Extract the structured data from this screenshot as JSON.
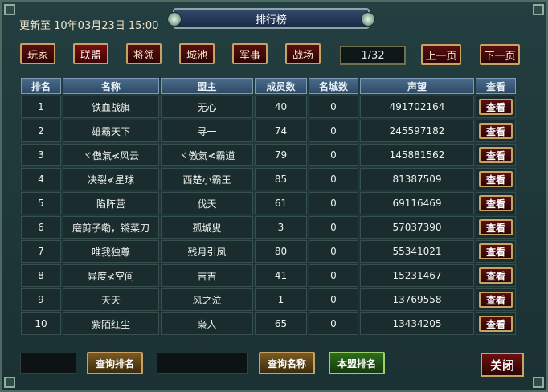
{
  "header": {
    "updated": "更新至 10年03月23日 15:00",
    "title": "排行榜"
  },
  "tabs": [
    {
      "label": "玩家",
      "active": false
    },
    {
      "label": "联盟",
      "active": true
    },
    {
      "label": "将领",
      "active": false
    },
    {
      "label": "城池",
      "active": false
    },
    {
      "label": "军事",
      "active": false
    },
    {
      "label": "战场",
      "active": false
    }
  ],
  "pagination": {
    "page": "1/32",
    "prev_label": "上一页",
    "next_label": "下一页"
  },
  "table": {
    "columns": [
      "排名",
      "名称",
      "盟主",
      "成员数",
      "名城数",
      "声望",
      "查看"
    ],
    "rows": [
      {
        "rank": "1",
        "name": "铁血战旗",
        "leader": "无心",
        "members": "40",
        "cities": "0",
        "prestige": "491702164",
        "view": "查看"
      },
      {
        "rank": "2",
        "name": "雄霸天下",
        "leader": "寻一",
        "members": "74",
        "cities": "0",
        "prestige": "245597182",
        "view": "查看"
      },
      {
        "rank": "3",
        "name": "ヾ傲氣≮风云",
        "leader": "ヾ傲氣≮霸道",
        "members": "79",
        "cities": "0",
        "prestige": "145881562",
        "view": "查看"
      },
      {
        "rank": "4",
        "name": "决裂≮星球",
        "leader": "西楚小霸王",
        "members": "85",
        "cities": "0",
        "prestige": "81387509",
        "view": "查看"
      },
      {
        "rank": "5",
        "name": "陷阵营",
        "leader": "伐天",
        "members": "61",
        "cities": "0",
        "prestige": "69116469",
        "view": "查看"
      },
      {
        "rank": "6",
        "name": "磨剪子嘞，锵菜刀",
        "leader": "孤城叟",
        "members": "3",
        "cities": "0",
        "prestige": "57037390",
        "view": "查看"
      },
      {
        "rank": "7",
        "name": "唯我独尊",
        "leader": "残月引凤",
        "members": "80",
        "cities": "0",
        "prestige": "55341021",
        "view": "查看"
      },
      {
        "rank": "8",
        "name": "异度≮空间",
        "leader": "吉吉",
        "members": "41",
        "cities": "0",
        "prestige": "15231467",
        "view": "查看"
      },
      {
        "rank": "9",
        "name": "天天",
        "leader": "风之泣",
        "members": "1",
        "cities": "0",
        "prestige": "13769558",
        "view": "查看"
      },
      {
        "rank": "10",
        "name": "紫陌红尘",
        "leader": "枭人",
        "members": "65",
        "cities": "0",
        "prestige": "13434205",
        "view": "查看"
      }
    ]
  },
  "footer": {
    "rank_input_value": "",
    "query_rank_label": "查询排名",
    "name_input_value": "",
    "query_name_label": "查询名称",
    "my_alliance_label": "本盟排名",
    "close_label": "关闭"
  }
}
